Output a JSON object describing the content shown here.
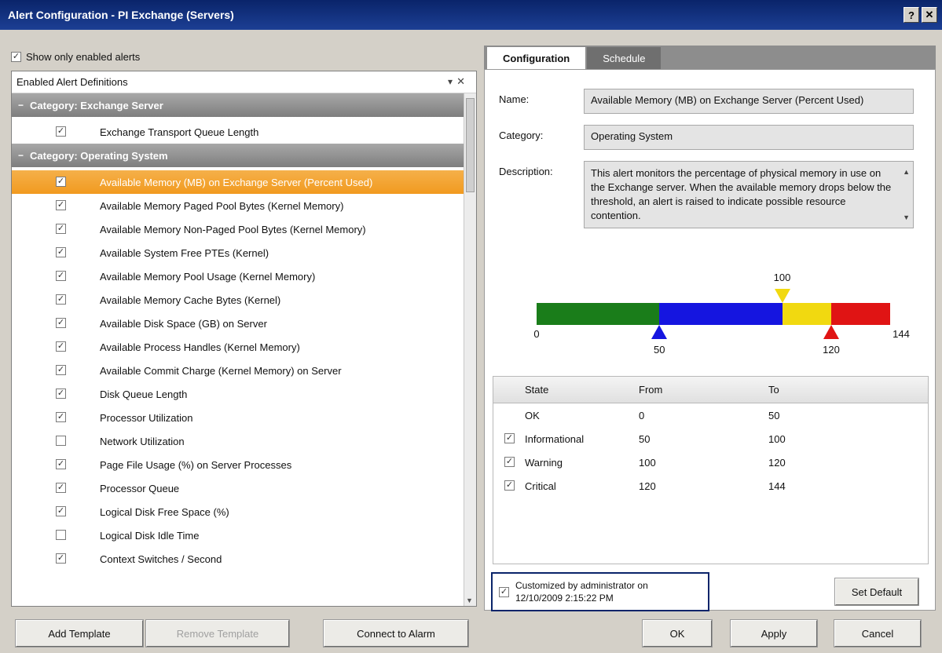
{
  "window": {
    "title": "Alert Configuration - PI Exchange (Servers)",
    "help_label": "?",
    "close_label": "✕"
  },
  "left": {
    "show_all_label": "Show only enabled alerts",
    "show_all_checked": true,
    "tree_header": "Enabled Alert Definitions",
    "pin_icon": "pin-icon",
    "close_icon": "close-icon",
    "groups": [
      {
        "label": "Category: Exchange Server",
        "expanded": true,
        "items": [
          {
            "label": "Exchange Transport Queue Length",
            "checked": true,
            "selected": false
          }
        ]
      },
      {
        "label": "Category: Operating System",
        "expanded": true,
        "items": [
          {
            "label": "Available Memory (MB) on Exchange Server (Percent Used)",
            "checked": true,
            "selected": true
          },
          {
            "label": "Available Memory Paged Pool Bytes (Kernel Memory)",
            "checked": true,
            "selected": false
          },
          {
            "label": "Available Memory Non-Paged Pool Bytes (Kernel Memory)",
            "checked": true,
            "selected": false
          },
          {
            "label": "Available System Free PTEs (Kernel)",
            "checked": true,
            "selected": false
          },
          {
            "label": "Available Memory Pool Usage (Kernel Memory)",
            "checked": true,
            "selected": false
          },
          {
            "label": "Available Memory Cache Bytes (Kernel)",
            "checked": true,
            "selected": false
          },
          {
            "label": "Available Disk Space (GB) on Server",
            "checked": true,
            "selected": false
          },
          {
            "label": "Available Process Handles (Kernel Memory)",
            "checked": true,
            "selected": false
          },
          {
            "label": "Available Commit Charge (Kernel Memory) on Server",
            "checked": true,
            "selected": false
          },
          {
            "label": "Disk Queue Length",
            "checked": true,
            "selected": false
          },
          {
            "label": "Processor Utilization",
            "checked": true,
            "selected": false
          },
          {
            "label": "Network Utilization",
            "checked": false,
            "selected": false
          },
          {
            "label": "Page File Usage (%) on Server Processes",
            "checked": true,
            "selected": false
          },
          {
            "label": "Processor Queue",
            "checked": true,
            "selected": false
          },
          {
            "label": "Logical Disk Free Space (%)",
            "checked": true,
            "selected": false
          },
          {
            "label": "Logical Disk Idle Time",
            "checked": false,
            "selected": false
          },
          {
            "label": "Context Switches / Second",
            "checked": true,
            "selected": false
          }
        ]
      }
    ]
  },
  "right": {
    "tabs": [
      {
        "label": "Configuration",
        "active": true
      },
      {
        "label": "Schedule",
        "active": false
      }
    ],
    "fields": {
      "name_label": "Name:",
      "name_value": "Available Memory (MB) on Exchange Server (Percent Used)",
      "category_label": "Category:",
      "category_value": "Operating System",
      "description_label": "Description:",
      "description_value": "This alert monitors the percentage of physical memory in use on the Exchange server. When the available memory drops below the threshold, an alert is raised to indicate possible resource contention."
    },
    "thresholds": {
      "min_label": "0",
      "max_label": "144",
      "min": 0,
      "max": 144,
      "warning_value": 50,
      "warning_label": "50",
      "critical_value": 120,
      "critical_label": "120",
      "top_value": 100,
      "top_label": "100",
      "colors": {
        "ok": "#1a7d1a",
        "warning": "#1515e0",
        "high": "#f1d910",
        "critical": "#e01414"
      }
    },
    "grid": {
      "headers": {
        "state": "State",
        "from": "From",
        "to": "To"
      },
      "rows": [
        {
          "state": "OK",
          "from": "0",
          "to": "50",
          "checked": null
        },
        {
          "state": "Informational",
          "from": "50",
          "to": "100",
          "checked": true
        },
        {
          "state": "Warning",
          "from": "100",
          "to": "120",
          "checked": true
        },
        {
          "state": "Critical",
          "from": "120",
          "to": "144",
          "checked": true
        }
      ]
    },
    "customized": {
      "line1": "Customized by administrator on",
      "line2": "12/10/2009 2:15:22 PM",
      "checked": true
    },
    "set_default_label": "Set Default"
  },
  "footer": {
    "add_template_label": "Add Template",
    "remove_template_label": "Remove Template",
    "connect_to_alarm_label": "Connect to Alarm",
    "ok_label": "OK",
    "apply_label": "Apply",
    "cancel_label": "Cancel"
  }
}
